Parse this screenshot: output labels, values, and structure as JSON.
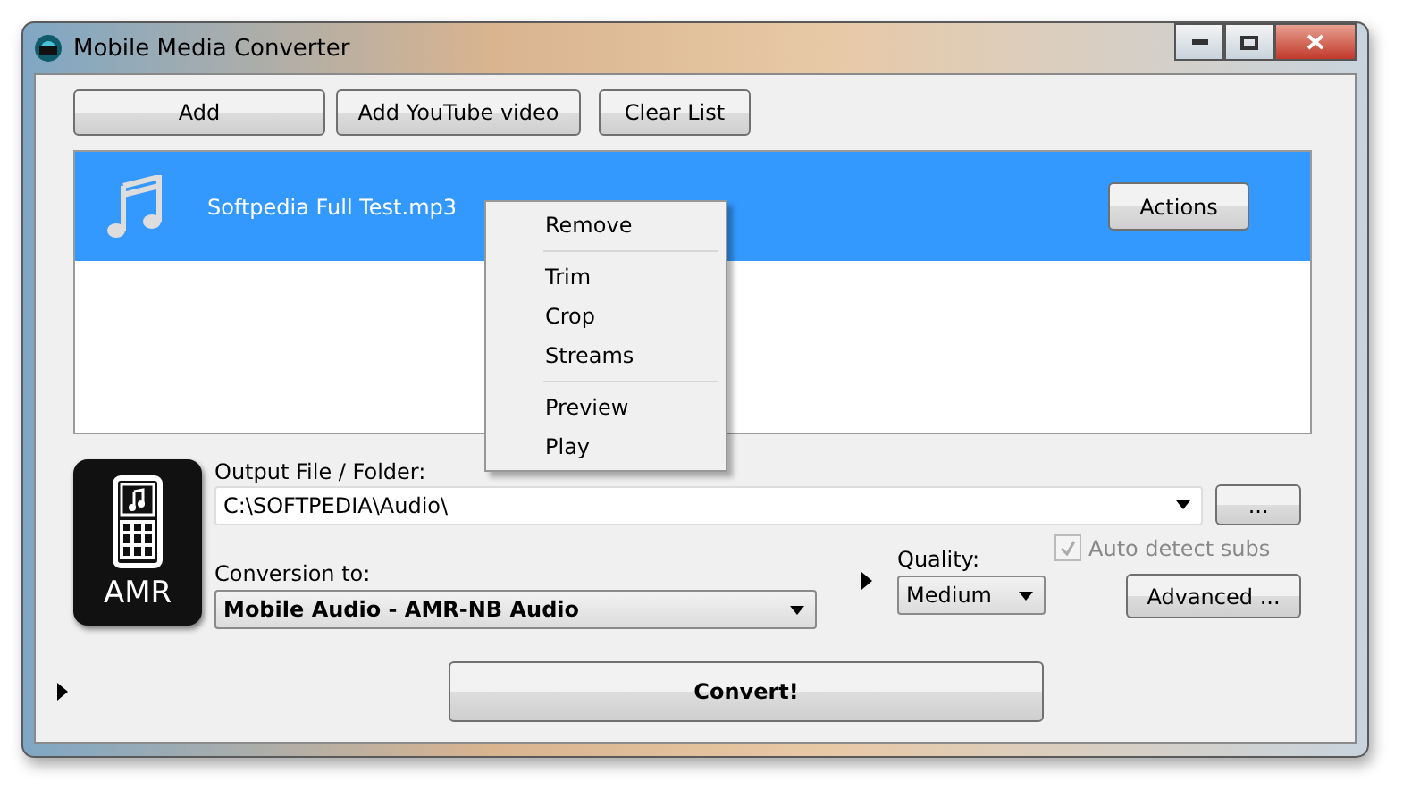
{
  "window": {
    "title": "Mobile Media Converter"
  },
  "toolbar": [
    "Add",
    "Add YouTube video",
    "Clear List"
  ],
  "files": [
    {
      "name": "Softpedia Full Test.mp3",
      "selected": true,
      "action": "Actions"
    }
  ],
  "context_menu": {
    "groups": [
      [
        "Remove"
      ],
      [
        "Trim",
        "Crop",
        "Streams"
      ],
      [
        "Preview",
        "Play"
      ]
    ]
  },
  "format_icon": {
    "label": "AMR"
  },
  "output": {
    "label": "Output File / Folder:",
    "value": "C:\\SOFTPEDIA\\Audio\\",
    "browse": "..."
  },
  "conversion": {
    "label": "Conversion to:",
    "value": "Mobile Audio - AMR-NB Audio"
  },
  "quality": {
    "label": "Quality:",
    "value": "Medium"
  },
  "auto_detect_subs": {
    "label": "Auto detect subs",
    "checked": true,
    "disabled": true
  },
  "advanced": "Advanced ...",
  "convert": "Convert!"
}
